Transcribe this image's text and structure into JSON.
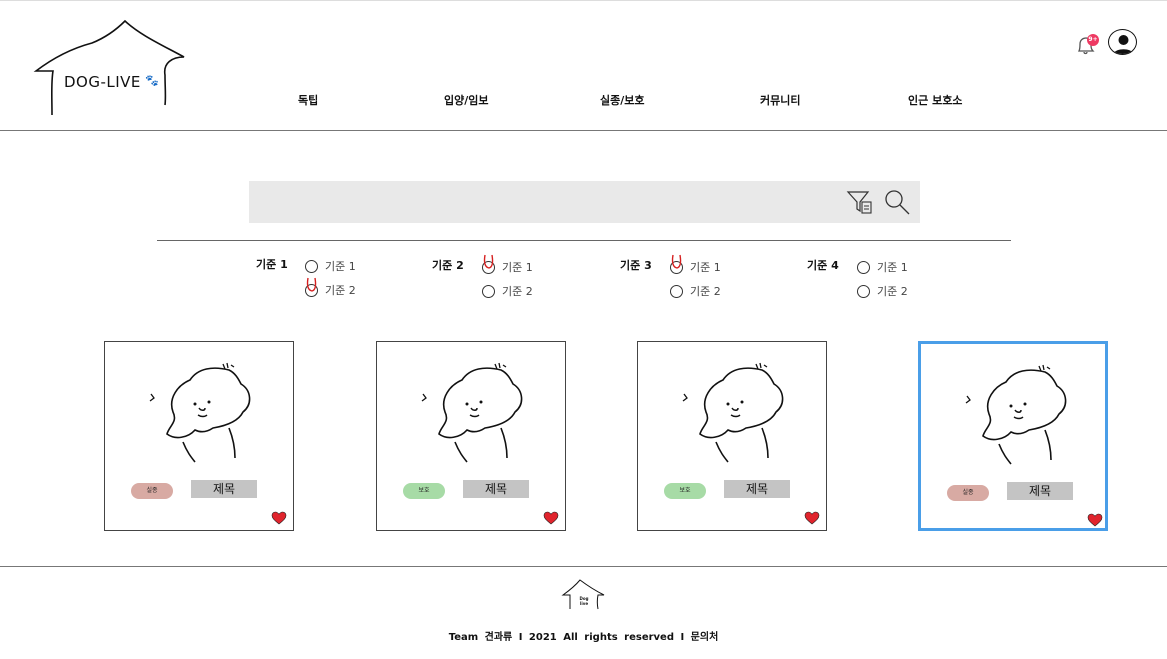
{
  "brand": {
    "logo_text": "DOG-LIVE",
    "paw_icon": "paw-icon"
  },
  "nav": [
    {
      "label": "독팁"
    },
    {
      "label": "입양/임보"
    },
    {
      "label": "실종/보호"
    },
    {
      "label": "커뮤니티"
    },
    {
      "label": "인근 보호소"
    }
  ],
  "notifications": {
    "badge": "9+",
    "icon": "bell-icon",
    "badge_color": "#ee3a63"
  },
  "profile": {
    "icon": "user-avatar-icon"
  },
  "search": {
    "value": "",
    "filter_icon": "filter-icon",
    "search_icon": "search-icon",
    "background": "#e9e9e9"
  },
  "criteria": [
    {
      "title": "기준 1",
      "options": [
        {
          "label": "기준 1",
          "marked": false
        },
        {
          "label": "기준 2",
          "marked": true
        }
      ]
    },
    {
      "title": "기준 2",
      "options": [
        {
          "label": "기준 1",
          "marked": true
        },
        {
          "label": "기준 2",
          "marked": false
        }
      ]
    },
    {
      "title": "기준 3",
      "options": [
        {
          "label": "기준 1",
          "marked": true
        },
        {
          "label": "기준 2",
          "marked": false
        }
      ]
    },
    {
      "title": "기준 4",
      "options": [
        {
          "label": "기준 1",
          "marked": false
        },
        {
          "label": "기준 2",
          "marked": false
        }
      ]
    }
  ],
  "cards": [
    {
      "badge": "실종",
      "badge_color": "#d8aaa3",
      "title": "제목",
      "liked": true,
      "selected": false
    },
    {
      "badge": "보호",
      "badge_color": "#a7dba6",
      "title": "제목",
      "liked": true,
      "selected": false
    },
    {
      "badge": "보호",
      "badge_color": "#a7dba6",
      "title": "제목",
      "liked": true,
      "selected": false
    },
    {
      "badge": "실종",
      "badge_color": "#d8aaa3",
      "title": "제목",
      "liked": true,
      "selected": true
    }
  ],
  "colors": {
    "heart": "#e0242d",
    "selected_border": "#4a9ee8",
    "check_mark": "#d62020"
  },
  "footer": {
    "logo_text": "Dog live",
    "copyright": "Team 견과류 I 2021 All rights reserved I 문의처"
  }
}
